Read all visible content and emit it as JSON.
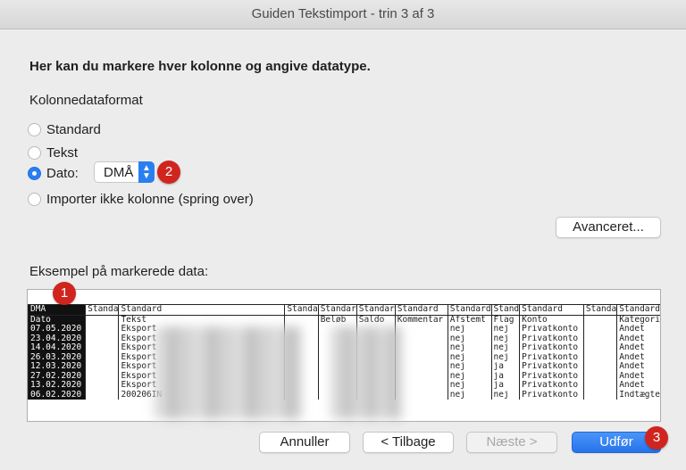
{
  "window": {
    "title": "Guiden Tekstimport - trin 3 af 3"
  },
  "heading": "Her kan du markere hver kolonne og angive datatype.",
  "format_label": "Kolonnedataformat",
  "radios": [
    {
      "label": "Standard",
      "selected": false
    },
    {
      "label": "Tekst",
      "selected": false
    },
    {
      "label": "Dato:",
      "selected": true
    },
    {
      "label": "Importer ikke kolonne (spring over)",
      "selected": false
    }
  ],
  "date_select": {
    "value": "DMÅ",
    "arrows": "▲▼"
  },
  "badges": [
    "1",
    "2",
    "3"
  ],
  "advanced_button": "Avanceret...",
  "preview_label": "Eksempel på markerede data:",
  "preview": {
    "header": [
      "DMÅ",
      "Standa",
      "Standard",
      "Standa",
      "Standar",
      "Standar",
      "Standard",
      "Standard",
      "Stand",
      "Standard",
      "Standa",
      "Standard"
    ],
    "rows": [
      [
        "Dato",
        "",
        "Tekst",
        "",
        "Beløb",
        "Saldo",
        "Kommentar",
        "Afstemt",
        "Flag",
        "Konto",
        "",
        "Kategori"
      ],
      [
        "07.05.2020",
        "",
        "Eksport",
        "",
        "",
        "",
        "",
        "nej",
        "nej",
        "Privatkonto",
        "",
        "Andet"
      ],
      [
        "23.04.2020",
        "",
        "Eksport",
        "",
        "",
        "",
        "",
        "nej",
        "nej",
        "Privatkonto",
        "",
        "Andet"
      ],
      [
        "14.04.2020",
        "",
        "Eksport",
        "",
        "",
        "",
        "",
        "nej",
        "nej",
        "Privatkonto",
        "",
        "Andet"
      ],
      [
        "26.03.2020",
        "",
        "Eksport",
        "",
        "",
        "",
        "",
        "nej",
        "nej",
        "Privatkonto",
        "",
        "Andet"
      ],
      [
        "12.03.2020",
        "",
        "Eksport",
        "",
        "",
        "",
        "",
        "nej",
        "ja",
        "Privatkonto",
        "",
        "Andet"
      ],
      [
        "27.02.2020",
        "",
        "Eksport",
        "",
        "",
        "",
        "",
        "nej",
        "ja",
        "Privatkonto",
        "",
        "Andet"
      ],
      [
        "13.02.2020",
        "",
        "Eksport",
        "",
        "",
        "",
        "",
        "nej",
        "ja",
        "Privatkonto",
        "",
        "Andet"
      ],
      [
        "06.02.2020",
        "",
        "200206IN",
        "",
        "",
        "",
        "",
        "nej",
        "nej",
        "Privatkonto",
        "",
        "Indtægte"
      ]
    ]
  },
  "buttons": {
    "cancel": "Annuller",
    "back": "< Tilbage",
    "next": "Næste >",
    "finish": "Udfør"
  },
  "colors": {
    "accent": "#2a7ff0",
    "badge": "#d0251f"
  }
}
